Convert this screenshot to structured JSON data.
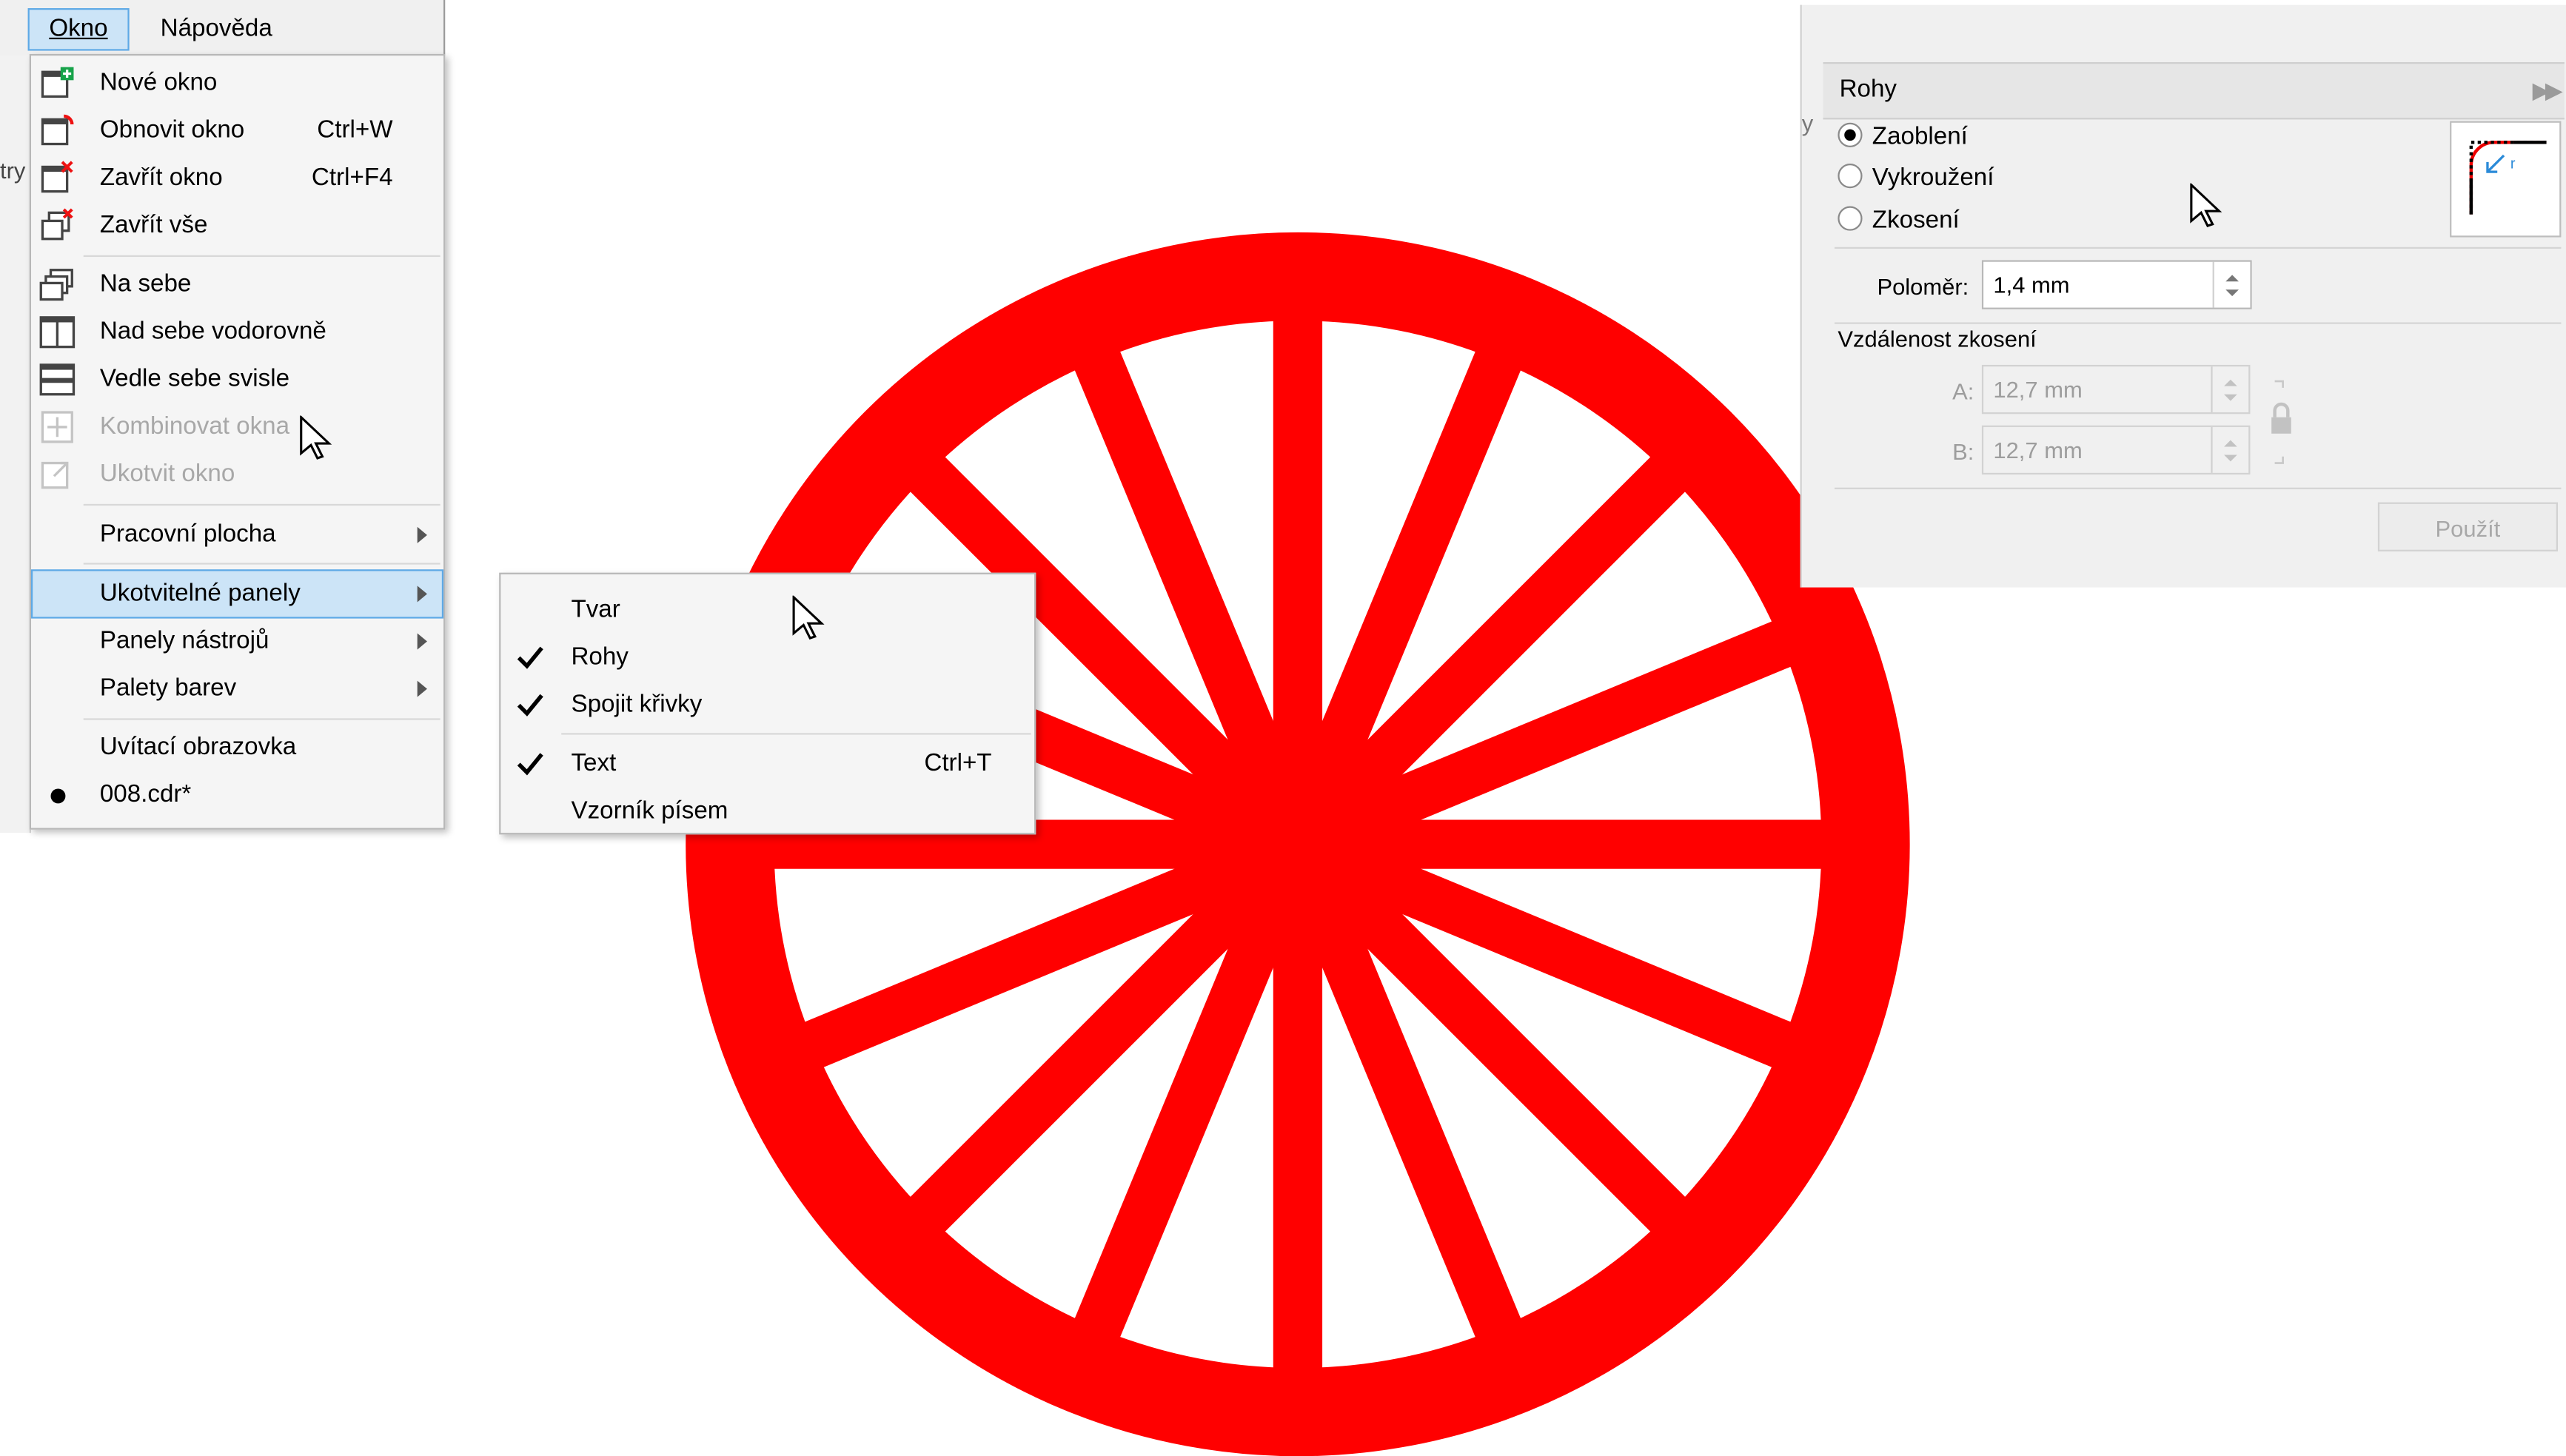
{
  "menubar": {
    "items": [
      {
        "label": "Okno",
        "active": true
      },
      {
        "label": "Nápověda",
        "active": false
      }
    ]
  },
  "window_menu": {
    "items": [
      {
        "label": "Nové okno",
        "shortcut": "",
        "icon": "new-window-icon",
        "enabled": true
      },
      {
        "label": "Obnovit okno",
        "shortcut": "Ctrl+W",
        "icon": "refresh-window-icon",
        "enabled": true
      },
      {
        "label": "Zavřít okno",
        "shortcut": "Ctrl+F4",
        "icon": "close-window-icon",
        "enabled": true
      },
      {
        "label": "Zavřít vše",
        "shortcut": "",
        "icon": "close-all-icon",
        "enabled": true
      },
      {
        "label": "Na sebe",
        "shortcut": "",
        "icon": "cascade-icon",
        "enabled": true
      },
      {
        "label": "Nad sebe vodorovně",
        "shortcut": "",
        "icon": "tile-horizontal-icon",
        "enabled": true
      },
      {
        "label": "Vedle sebe svisle",
        "shortcut": "",
        "icon": "tile-vertical-icon",
        "enabled": true
      },
      {
        "label": "Kombinovat okna",
        "shortcut": "",
        "icon": "combine-windows-icon",
        "enabled": false
      },
      {
        "label": "Ukotvit okno",
        "shortcut": "",
        "icon": "dock-window-icon",
        "enabled": false
      },
      {
        "label": "Pracovní plocha",
        "submenu": true
      },
      {
        "label": "Ukotvitelné panely",
        "submenu": true,
        "highlighted": true
      },
      {
        "label": "Panely nástrojů",
        "submenu": true
      },
      {
        "label": "Palety barev",
        "submenu": true
      },
      {
        "label": "Uvítací obrazovka"
      },
      {
        "label": "008.cdr*",
        "bullet": true
      }
    ]
  },
  "dockers_submenu": {
    "items": [
      {
        "label": "Tvar",
        "checked": false,
        "shortcut": ""
      },
      {
        "label": "Rohy",
        "checked": true,
        "shortcut": ""
      },
      {
        "label": "Spojit křivky",
        "checked": true,
        "shortcut": ""
      },
      {
        "label": "Text",
        "checked": true,
        "shortcut": "Ctrl+T"
      },
      {
        "label": "Vzorník písem",
        "checked": false,
        "shortcut": ""
      }
    ]
  },
  "corners_docker": {
    "title": "Rohy",
    "modes": [
      {
        "label": "Zaoblení",
        "selected": true
      },
      {
        "label": "Vykroužení",
        "selected": false
      },
      {
        "label": "Zkosení",
        "selected": false
      }
    ],
    "radius_label": "Poloměr:",
    "radius_value": "1,4 mm",
    "chamfer_section": "Vzdálenost zkosení",
    "chamfer_a_label": "A:",
    "chamfer_a_value": "12,7 mm",
    "chamfer_b_label": "B:",
    "chamfer_b_value": "12,7 mm",
    "apply_label": "Použít"
  },
  "edge_fragments": {
    "left_text": "try",
    "docker_left_text": "y"
  },
  "colors": {
    "wheel": "#ff0000",
    "menu_highlight": "#cce4f7",
    "highlight_border": "#5ea9e6"
  }
}
